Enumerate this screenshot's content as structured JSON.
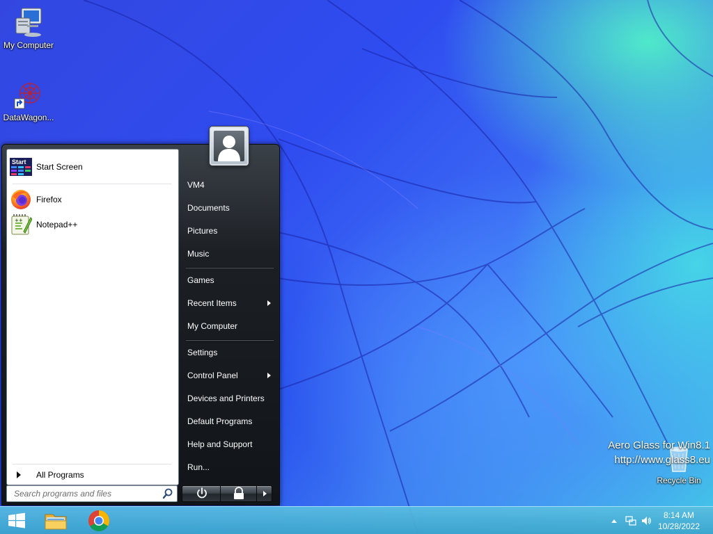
{
  "desktop": {
    "icons": [
      {
        "label": "My Computer",
        "icon": "computer-icon"
      },
      {
        "label": "DataWagon...",
        "icon": "datawagon-shortcut-icon"
      },
      {
        "label": "Recycle Bin",
        "icon": "recycle-bin-icon"
      }
    ],
    "watermark": {
      "line1": "Aero Glass for Win8.1",
      "line2": "http://www.glass8.eu"
    }
  },
  "start_menu": {
    "programs": [
      {
        "label": "Start Screen",
        "icon": "start-screen-icon"
      },
      {
        "label": "Firefox",
        "icon": "firefox-icon"
      },
      {
        "label": "Notepad++",
        "icon": "notepadpp-icon"
      }
    ],
    "start_screen_tile_text": "Start",
    "all_programs": "All Programs",
    "search_placeholder": "Search programs and files",
    "right_items": [
      {
        "label": "VM4"
      },
      {
        "label": "Documents"
      },
      {
        "label": "Pictures"
      },
      {
        "label": "Music"
      },
      {
        "label": "Games"
      },
      {
        "label": "Recent Items",
        "submenu": true
      },
      {
        "label": "My Computer"
      },
      {
        "label": "Settings"
      },
      {
        "label": "Control Panel",
        "submenu": true
      },
      {
        "label": "Devices and Printers"
      },
      {
        "label": "Default Programs"
      },
      {
        "label": "Help and Support"
      },
      {
        "label": "Run..."
      }
    ]
  },
  "taskbar": {
    "pinned": [
      {
        "name": "start-button",
        "icon": "windows-logo-icon"
      },
      {
        "name": "file-explorer",
        "icon": "folder-icon"
      },
      {
        "name": "chrome",
        "icon": "chrome-icon"
      }
    ],
    "clock": {
      "time": "8:14 AM",
      "date": "10/28/2022"
    }
  },
  "colors": {
    "menu_dark": "#1c2025",
    "taskbar": "#4fb3d9",
    "wallpaper_blue": "#2f4cf0",
    "wallpaper_cyan": "#44c8e8"
  }
}
